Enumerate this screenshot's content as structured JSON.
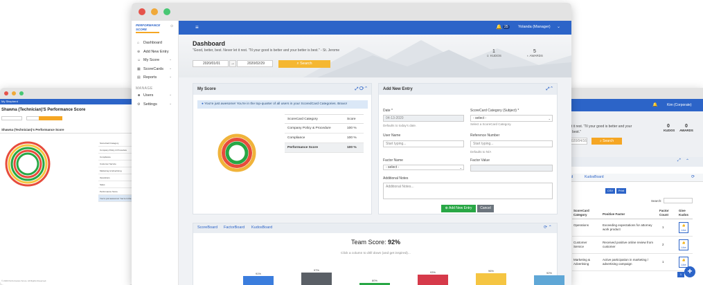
{
  "app": {
    "logo_text": "PERFORMANCE SCORE"
  },
  "topbar": {
    "notif_count": "25",
    "user": "Yolanda (Manager)"
  },
  "sidebar": {
    "items": [
      {
        "label": "Dashboard"
      },
      {
        "label": "Add New Entry"
      },
      {
        "label": "My Score"
      },
      {
        "label": "ScoreCards"
      },
      {
        "label": "Reports"
      }
    ],
    "manage_heading": "MANAGE",
    "manage_items": [
      {
        "label": "Users"
      },
      {
        "label": "Settings"
      }
    ]
  },
  "dashboard": {
    "title": "Dashboard",
    "quote": "\"Good, better, best. Never let it rest. 'Til your good is better and your better is best.\" - St. Jerome",
    "date_from": "2020/01/01",
    "date_to": "2020/02/29",
    "search_label": "Search",
    "kudos_count": "1",
    "kudos_label": "KUDOS",
    "awards_count": "5",
    "awards_label": "AWARDS"
  },
  "my_score": {
    "title": "My Score",
    "alert": "You're just awesome! You're in the top-quarter of all users in your ScoredCard Categories. Bravo!",
    "col_category": "ScoreCard Category",
    "col_score": "Score",
    "rows": [
      {
        "category": "Company Policy & Procedure",
        "score": "100 %"
      },
      {
        "category": "Compliance",
        "score": "100 %"
      },
      {
        "category": "Performance Score",
        "score": "100 %"
      }
    ]
  },
  "add_entry": {
    "title": "Add New Entry",
    "date_label": "Date *",
    "date_value": "04-13-2020",
    "date_hint": "Defaults to today's date.",
    "category_label": "ScoreCard Category (Subject) *",
    "category_value": "- select -",
    "category_hint": "Select a ScoreCard Category.",
    "user_label": "User Name",
    "user_placeholder": "Start typing...",
    "ref_label": "Reference Number",
    "ref_placeholder": "Start typing...",
    "ref_hint": "Defaults to N/A",
    "factor_name_label": "Factor Name",
    "factor_name_value": "- select -",
    "factor_value_label": "Factor Value",
    "notes_label": "Additional Notes",
    "notes_placeholder": "Additional Notes...",
    "submit_label": "Add New Entry",
    "cancel_label": "Cancel"
  },
  "team": {
    "tabs": [
      {
        "label": "ScoreBoard"
      },
      {
        "label": "FactorBoard"
      },
      {
        "label": "KudosBoard"
      }
    ],
    "title": "Team Score:",
    "value": "92%",
    "subtitle": "Click a column to drill down (and get inspired)..."
  },
  "chart_data": {
    "type": "bar",
    "values": [
      91,
      97,
      80,
      93,
      96,
      92
    ],
    "labels": [
      "91%",
      "97%",
      "80%",
      "93%",
      "96%",
      "92%"
    ],
    "colors": [
      "#3b7ddd",
      "#5a5f66",
      "#28a745",
      "#d63a4a",
      "#f5c542",
      "#5fa7d6"
    ]
  },
  "left_window": {
    "tab_label": "My Shepherd",
    "title": "Shawna (Technician)'S Performance Score",
    "subtitle": "Shawna (Technician)'s Performance Score",
    "list_items": [
      "ScoreCard Category",
      "Company Policy & Procedure",
      "Compliance",
      "Customer Service",
      "Marketing & Advertising",
      "Operations",
      "Sales",
      "Performance Score",
      "You're just awesome! You're in the top..."
    ],
    "footer": "© 2020 Performance Score. All Rights Reserved."
  },
  "right_window": {
    "user": "Kim (Corporate)",
    "quote_fragment": "et it rest. 'Til your good is better and your",
    "quote_fragment2": "e best.\"",
    "date": "2020/04/16",
    "search_label": "Search",
    "kudos_count": "0",
    "kudos_label": "KUDOS",
    "awards_count": "0",
    "awards_label": "AWARDS",
    "tabs": [
      {
        "label": "ard"
      },
      {
        "label": "KudosBoard"
      }
    ],
    "csv_label": "CSV",
    "print_label": "Print",
    "search_field": "Search:",
    "col_category": "ScoreCard Category",
    "col_factor": "Positive Factor",
    "col_count": "Factor Count",
    "col_kudos": "Give Kudos",
    "rows": [
      {
        "category": "Operations",
        "factor": "Exceeding expectations for attorney work product",
        "count": "1",
        "kudos": "Like"
      },
      {
        "category": "Customer Service",
        "factor": "Received positive online review from customer",
        "count": "2",
        "kudos": "Like"
      },
      {
        "category": "Marketing & Advertising",
        "factor": "Active participation in marketing / advertising campaign",
        "count": "1",
        "kudos": "Like"
      }
    ]
  }
}
